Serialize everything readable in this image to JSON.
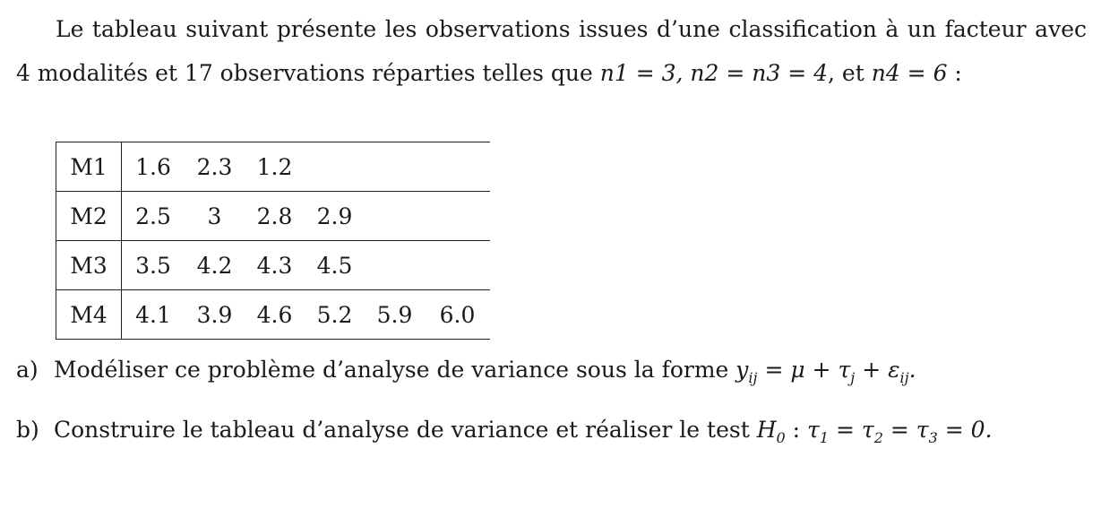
{
  "intro": {
    "text_1": "Le tableau suivant présente les observations issues d’une classification à un facteur avec 4 modalités et 17 observations réparties telles que ",
    "math": "n1 = 3, n2 = n3 = 4",
    "text_2": ", et ",
    "math_2": "n4 = 6",
    "text_3": " :"
  },
  "table": {
    "rows": [
      {
        "label": "M1",
        "values": [
          "1.6",
          "2.3",
          "1.2",
          "",
          "",
          ""
        ]
      },
      {
        "label": "M2",
        "values": [
          "2.5",
          "3",
          "2.8",
          "2.9",
          "",
          ""
        ]
      },
      {
        "label": "M3",
        "values": [
          "3.5",
          "4.2",
          "4.3",
          "4.5",
          "",
          ""
        ]
      },
      {
        "label": "M4",
        "values": [
          "4.1",
          "3.9",
          "4.6",
          "5.2",
          "5.9",
          "6.0"
        ]
      }
    ]
  },
  "questions": {
    "a": {
      "label": "a)",
      "text": "Modéliser ce problème d’analyse de variance sous la forme ",
      "formula": "yij = μ + τj + εij."
    },
    "b": {
      "label": "b)",
      "text": "Construire le tableau d’analyse de variance et réaliser le test ",
      "formula": "H0 : τ1 = τ2 = τ3 = 0."
    }
  }
}
